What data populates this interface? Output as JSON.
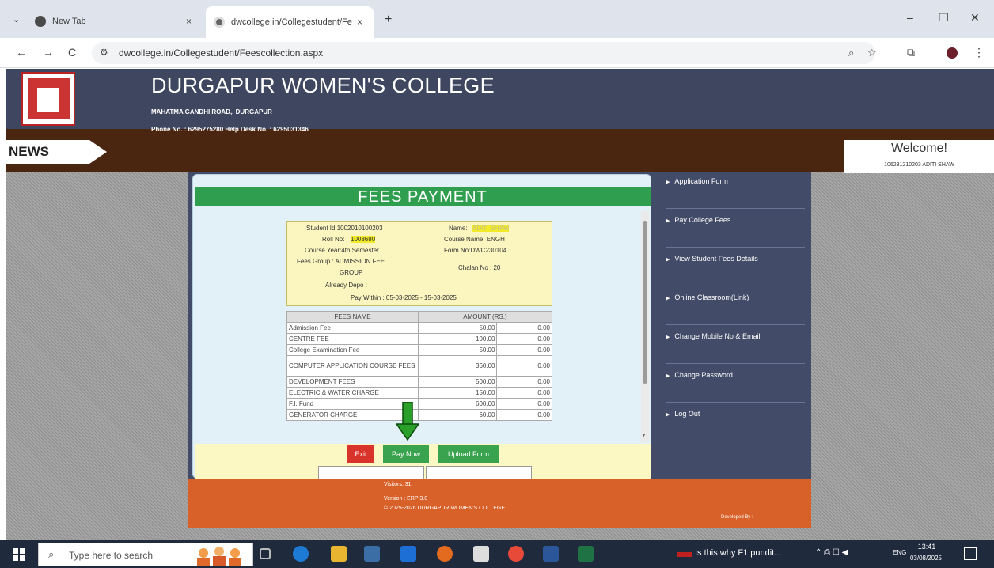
{
  "browser": {
    "tabs": [
      {
        "label": "New Tab"
      },
      {
        "label": "dwcollege.in/Collegestudent/Fe"
      }
    ],
    "tab_close": "×",
    "new_tab": "+",
    "url": "dwcollege.in/Collegestudent/Feescollection.aspx",
    "nav": {
      "back": "←",
      "forward": "→",
      "reload": "C"
    },
    "window_controls": {
      "minimize": "–",
      "restore": "❐",
      "close": "✕"
    }
  },
  "header": {
    "college_name": "DURGAPUR WOMEN'S COLLEGE",
    "address": "MAHATMA GANDHI ROAD,, DURGAPUR",
    "phone": "Phone No. : 6295275280    Help Desk No. : 6295031346"
  },
  "news": {
    "label": "NEWS"
  },
  "welcome": {
    "title": "Welcome!",
    "user": "106231210203 ADITI SHAW"
  },
  "fees": {
    "title": "FEES PAYMENT",
    "student": {
      "student_id": "Student Id:1002010100203",
      "name_label": "Name:",
      "name_value": "ADITI SHAW",
      "roll_label": "Roll No:",
      "roll_value": "1008680",
      "course_name": "Course Name: ENGH",
      "course_year": "Course Year:4th Semester",
      "form_no": "Form No:DWC230104",
      "fees_group": "Fees Group : ADMISSION FEE",
      "fees_group_cont": "GROUP",
      "chalan": "Chalan No : 20",
      "already_depo": "Already Depo :",
      "pay_within": "Pay Within : 05-03-2025 - 15-03-2025"
    },
    "table": {
      "headers": [
        "FEES NAME",
        "AMOUNT (RS.)",
        ""
      ],
      "rows": [
        [
          "Admission Fee",
          "50.00",
          "0.00"
        ],
        [
          "CENTRE FEE",
          "100.00",
          "0.00"
        ],
        [
          "College Examination Fee",
          "50.00",
          "0.00"
        ],
        [
          "COMPUTER APPLICATION COURSE FEES",
          "360.00",
          "0.00"
        ],
        [
          "DEVELOPMENT FEES",
          "500.00",
          "0.00"
        ],
        [
          "ELECTRIC & WATER CHARGE",
          "150.00",
          "0.00"
        ],
        [
          "F.I. Fund",
          "600.00",
          "0.00"
        ],
        [
          "GENERATOR CHARGE",
          "60.00",
          "0.00"
        ]
      ]
    },
    "buttons": {
      "exit": "Exit",
      "pay_now": "Pay Now",
      "upload": "Upload Form"
    }
  },
  "menu": [
    {
      "label": "Application Form"
    },
    {
      "label": "Pay College Fees"
    },
    {
      "label": "View Student Fees Details"
    },
    {
      "label": "Online Classroom(Link)"
    },
    {
      "label": "Change Mobile No & Email"
    },
    {
      "label": "Change Password"
    },
    {
      "label": "Log Out"
    }
  ],
  "footer": {
    "visitors": "Visitors: 31",
    "version": "Version : ERP 3.0",
    "copyright": "© 2025-2026   DURGAPUR WOMEN'S COLLEGE",
    "developed": "Developed By :"
  },
  "taskbar": {
    "search_placeholder": "Type here to search",
    "news": "Is this why F1 pundit...",
    "lang": "ENG",
    "time": "13:41",
    "date": "03/08/2025"
  },
  "colors": {
    "header_bg": "#3e4660",
    "news_bar": "#4a2510",
    "fees_title": "#2f9e4f",
    "footer": "#d8612a",
    "exit_btn": "#d9342b",
    "pay_btn": "#3aa34f"
  },
  "icons": {
    "tab_menu": "chevron-down-icon",
    "new_tab_favicon": "chrome-icon",
    "site_favicon": "globe-icon",
    "site_info": "tune-icon",
    "zoom": "search-icon",
    "bookmark": "star-icon",
    "extensions": "puzzle-icon",
    "profile": "avatar-icon",
    "more": "kebab-icon",
    "menu_bullet": "triangle-right-icon"
  }
}
